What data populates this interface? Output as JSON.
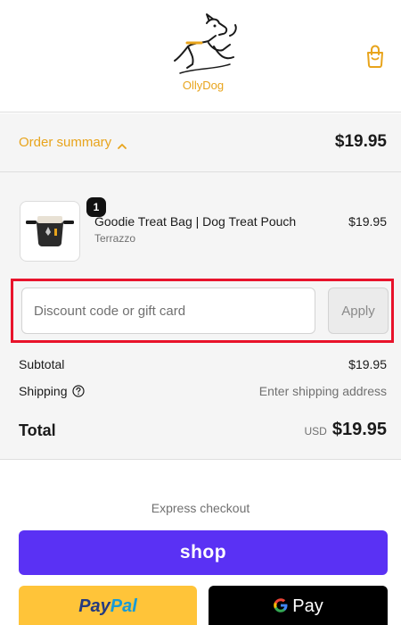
{
  "header": {
    "logo_text": "OllyDog",
    "logo_icon": "dog-logo-icon",
    "cart_icon": "shopping-bag-icon"
  },
  "summary": {
    "toggle_label": "Order summary",
    "toggle_total": "$19.95"
  },
  "product": {
    "name": "Goodie Treat Bag | Dog Treat Pouch",
    "variant": "Terrazzo",
    "price": "$19.95",
    "quantity": "1",
    "thumbnail_icon": "treat-pouch-icon"
  },
  "discount": {
    "placeholder": "Discount code or gift card",
    "value": "",
    "apply_label": "Apply"
  },
  "totals": {
    "subtotal_label": "Subtotal",
    "subtotal_value": "$19.95",
    "shipping_label": "Shipping",
    "shipping_value": "Enter shipping address",
    "total_label": "Total",
    "currency": "USD",
    "total_value": "$19.95"
  },
  "express": {
    "label": "Express checkout",
    "shop_label": "shop",
    "paypal_pay": "Pay",
    "paypal_pal": "Pal",
    "gpay_label": "Pay"
  },
  "colors": {
    "accent": "#e8a41c",
    "highlight_border": "#e8132b",
    "shop_pay": "#5a31f4",
    "paypal": "#ffc439",
    "gpay": "#000000"
  }
}
